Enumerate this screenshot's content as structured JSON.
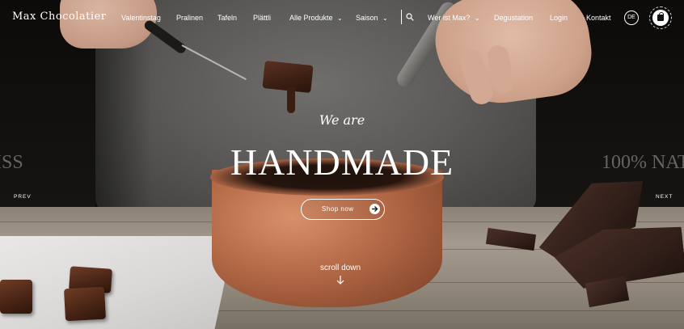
{
  "brand": {
    "logo_text": "Max Chocolatier"
  },
  "nav": {
    "items": [
      {
        "label": "Valentinstag",
        "caret": ""
      },
      {
        "label": "Pralinen",
        "caret": ""
      },
      {
        "label": "Tafeln",
        "caret": ""
      },
      {
        "label": "Plättli",
        "caret": ""
      },
      {
        "label": "Alle Produkte",
        "caret": "⌄"
      },
      {
        "label": "Saison",
        "caret": "⌄"
      },
      {
        "label": "Wer ist Max?",
        "caret": "⌄"
      },
      {
        "label": "Degustation",
        "caret": ""
      },
      {
        "label": "Login",
        "caret": ""
      },
      {
        "label": "Kontakt",
        "caret": ""
      }
    ],
    "language": "DE"
  },
  "hero": {
    "kicker": "We are",
    "headline": "HANDMADE",
    "prev_slide_ghost": "ISS",
    "next_slide_ghost": "100% NAT",
    "prev_label": "PREV",
    "next_label": "NEXT",
    "cta_label": "Shop now",
    "scroll_label": "scroll down"
  },
  "colors": {
    "text": "#ffffff",
    "background": "#0e0c0b",
    "copper": "#b86d4a",
    "chocolate": "#4a2516"
  },
  "icons": [
    "search-icon",
    "chevron-down-icon",
    "language-badge",
    "shopping-bag-icon",
    "arrow-right-icon",
    "arrow-down-icon"
  ]
}
